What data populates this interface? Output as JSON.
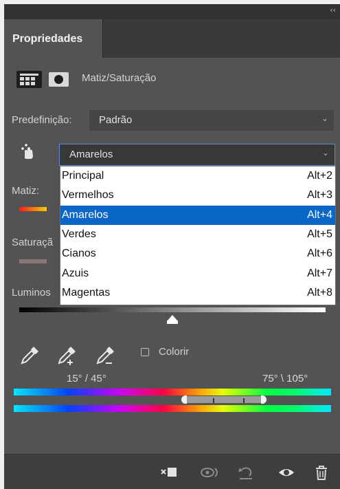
{
  "panel": {
    "tab_label": "Propriedades",
    "collapse_glyph": "‹‹",
    "adjustment_title": "Matiz/Saturação"
  },
  "preset": {
    "label": "Predefinição:",
    "value": "Padrão"
  },
  "channel": {
    "value": "Amarelos",
    "options": [
      {
        "name": "Principal",
        "shortcut": "Alt+2"
      },
      {
        "name": "Vermelhos",
        "shortcut": "Alt+3"
      },
      {
        "name": "Amarelos",
        "shortcut": "Alt+4",
        "selected": true
      },
      {
        "name": "Verdes",
        "shortcut": "Alt+5"
      },
      {
        "name": "Cianos",
        "shortcut": "Alt+6"
      },
      {
        "name": "Azuis",
        "shortcut": "Alt+7"
      },
      {
        "name": "Magentas",
        "shortcut": "Alt+8"
      }
    ]
  },
  "sliders": {
    "hue_label": "Matiz:",
    "saturation_label": "Saturaçã",
    "lightness_label": "Luminos"
  },
  "colorize": {
    "label": "Colorir",
    "checked": false
  },
  "range": {
    "left_text": "15° / 45°",
    "right_text": "75° \\ 105°"
  },
  "icons": {
    "adjust_panel": "huesat-adjustment-icon",
    "mask": "mask-icon",
    "targeted_adjust": "hand-targeted-adjust-icon",
    "droppers": [
      "eyedropper-icon",
      "eyedropper-add-icon",
      "eyedropper-subtract-icon"
    ],
    "bottom": [
      "clip-to-layer-icon",
      "view-previous-state-icon",
      "reset-icon",
      "visibility-eye-icon",
      "trash-icon"
    ]
  },
  "colors": {
    "panel_bg": "#535353",
    "selection": "#0a67c8",
    "dropdown_border_active": "#5b8dd0"
  }
}
